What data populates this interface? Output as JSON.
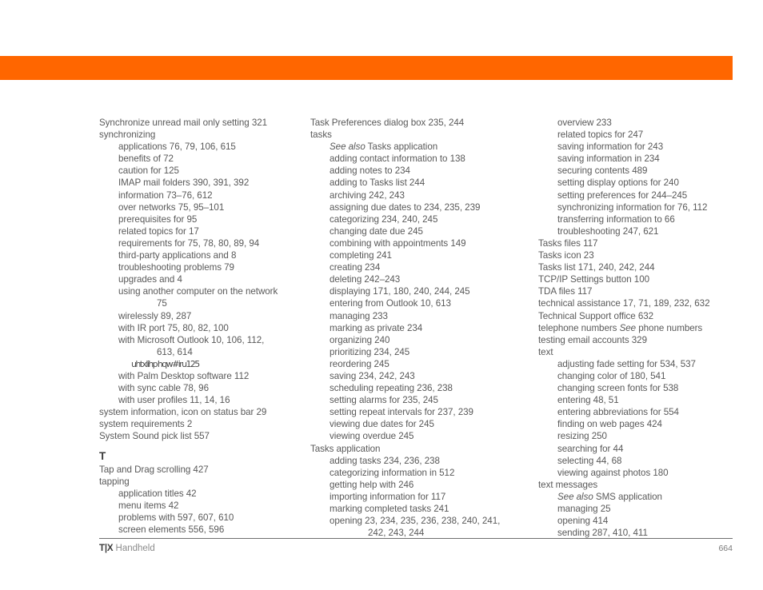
{
  "page": {
    "title": "T|X Handheld Index",
    "accent_color": "#ff6600",
    "text_color": "#595959",
    "page_number": "664"
  },
  "footer": {
    "brand": "T|X",
    "product": " Handheld",
    "page_number": "664"
  },
  "columns": [
    {
      "name": "column-1",
      "entries": [
        {
          "level": 0,
          "text": "Synchronize unread mail only setting 321"
        },
        {
          "level": 0,
          "text": "synchronizing"
        },
        {
          "level": 1,
          "text": "applications 76, 79, 106, 615"
        },
        {
          "level": 1,
          "text": "benefits of 72"
        },
        {
          "level": 1,
          "text": "caution for 125"
        },
        {
          "level": 1,
          "text": "IMAP mail folders 390, 391, 392"
        },
        {
          "level": 1,
          "text": "information 73–76, 612"
        },
        {
          "level": 1,
          "text": "over networks 75, 95–101"
        },
        {
          "level": 1,
          "text": "prerequisites for 95"
        },
        {
          "level": 1,
          "text": "related topics for 17"
        },
        {
          "level": 1,
          "text": "requirements for 75, 78, 80, 89, 94"
        },
        {
          "level": 1,
          "text": "third-party applications and 8"
        },
        {
          "level": 1,
          "text": "troubleshooting problems 79"
        },
        {
          "level": 1,
          "text": "upgrades and 4"
        },
        {
          "level": 1,
          "text": "using another computer on the network"
        },
        {
          "level": "cont",
          "text": "75"
        },
        {
          "level": 1,
          "text": "wirelessly 89, 287"
        },
        {
          "level": 1,
          "text": "with IR port 75, 80, 82, 100"
        },
        {
          "level": 1,
          "text": "with Microsoft Outlook 10, 106, 112,"
        },
        {
          "level": "cont",
          "text": "613, 614"
        },
        {
          "level": "glitch",
          "text": "uhtxlihp hqw#iru125"
        },
        {
          "level": 1,
          "text": "with Palm Desktop software 112"
        },
        {
          "level": 1,
          "text": "with sync cable 78, 96"
        },
        {
          "level": 1,
          "text": "with user profiles 11, 14, 16"
        },
        {
          "level": 0,
          "text": "system information, icon on status bar 29"
        },
        {
          "level": 0,
          "text": "system requirements 2"
        },
        {
          "level": 0,
          "text": "System Sound pick list 557"
        },
        {
          "level": "letter",
          "text": "T"
        },
        {
          "level": 0,
          "text": "Tap and Drag scrolling 427"
        },
        {
          "level": 0,
          "text": "tapping"
        },
        {
          "level": 1,
          "text": "application titles 42"
        },
        {
          "level": 1,
          "text": "menu items 42"
        },
        {
          "level": 1,
          "text": "problems with 597, 607, 610"
        },
        {
          "level": 1,
          "text": "screen elements 556, 596"
        }
      ]
    },
    {
      "name": "column-2",
      "entries": [
        {
          "level": 0,
          "text": "Task Preferences dialog box 235, 244"
        },
        {
          "level": 0,
          "text": "tasks"
        },
        {
          "level": 1,
          "italic_prefix": "See also",
          "text": " Tasks application"
        },
        {
          "level": 1,
          "text": "adding contact information to 138"
        },
        {
          "level": 1,
          "text": "adding notes to 234"
        },
        {
          "level": 1,
          "text": "adding to Tasks list 244"
        },
        {
          "level": 1,
          "text": "archiving 242, 243"
        },
        {
          "level": 1,
          "text": "assigning due dates to 234, 235, 239"
        },
        {
          "level": 1,
          "text": "categorizing 234, 240, 245"
        },
        {
          "level": 1,
          "text": "changing date due 245"
        },
        {
          "level": 1,
          "text": "combining with appointments 149"
        },
        {
          "level": 1,
          "text": "completing 241"
        },
        {
          "level": 1,
          "text": "creating 234"
        },
        {
          "level": 1,
          "text": "deleting 242–243"
        },
        {
          "level": 1,
          "text": "displaying 171, 180, 240, 244, 245"
        },
        {
          "level": 1,
          "text": "entering from Outlook 10, 613"
        },
        {
          "level": 1,
          "text": "managing 233"
        },
        {
          "level": 1,
          "text": "marking as private 234"
        },
        {
          "level": 1,
          "text": "organizing 240"
        },
        {
          "level": 1,
          "text": "prioritizing 234, 245"
        },
        {
          "level": 1,
          "text": "reordering 245"
        },
        {
          "level": 1,
          "text": "saving 234, 242, 243"
        },
        {
          "level": 1,
          "text": "scheduling repeating 236, 238"
        },
        {
          "level": 1,
          "text": "setting alarms for 235, 245"
        },
        {
          "level": 1,
          "text": "setting repeat intervals for 237, 239"
        },
        {
          "level": 1,
          "text": "viewing due dates for 245"
        },
        {
          "level": 1,
          "text": "viewing overdue 245"
        },
        {
          "level": 0,
          "text": "Tasks application"
        },
        {
          "level": 1,
          "text": "adding tasks 234, 236, 238"
        },
        {
          "level": 1,
          "text": "categorizing information in 512"
        },
        {
          "level": 1,
          "text": "getting help with 246"
        },
        {
          "level": 1,
          "text": "importing information for 117"
        },
        {
          "level": 1,
          "text": "marking completed tasks 241"
        },
        {
          "level": 1,
          "text": "opening 23, 234, 235, 236, 238, 240, 241,"
        },
        {
          "level": "cont",
          "text": "242, 243, 244"
        }
      ]
    },
    {
      "name": "column-3",
      "entries": [
        {
          "level": 1,
          "text": "overview 233"
        },
        {
          "level": 1,
          "text": "related topics for 247"
        },
        {
          "level": 1,
          "text": "saving information for 243"
        },
        {
          "level": 1,
          "text": "saving information in 234"
        },
        {
          "level": 1,
          "text": "securing contents 489"
        },
        {
          "level": 1,
          "text": "setting display options for 240"
        },
        {
          "level": 1,
          "text": "setting preferences for 244–245"
        },
        {
          "level": 1,
          "text": "synchronizing information for 76, 112"
        },
        {
          "level": 1,
          "text": "transferring information to 66"
        },
        {
          "level": 1,
          "text": "troubleshooting 247, 621"
        },
        {
          "level": 0,
          "text": "Tasks files 117"
        },
        {
          "level": 0,
          "text": "Tasks icon 23"
        },
        {
          "level": 0,
          "text": "Tasks list 171, 240, 242, 244"
        },
        {
          "level": 0,
          "text": "TCP/IP Settings button 100"
        },
        {
          "level": 0,
          "text": "TDA files 117"
        },
        {
          "level": 0,
          "text": "technical assistance 17, 71, 189, 232, 632"
        },
        {
          "level": 0,
          "text": "Technical Support office 632"
        },
        {
          "level": 0,
          "text": "telephone numbers ",
          "italic_mid": "See",
          "text_after": " phone numbers"
        },
        {
          "level": 0,
          "text": "testing email accounts 329"
        },
        {
          "level": 0,
          "text": "text"
        },
        {
          "level": 1,
          "text": "adjusting fade setting for 534, 537"
        },
        {
          "level": 1,
          "text": "changing color of 180, 541"
        },
        {
          "level": 1,
          "text": "changing screen fonts for 538"
        },
        {
          "level": 1,
          "text": "entering 48, 51"
        },
        {
          "level": 1,
          "text": "entering abbreviations for 554"
        },
        {
          "level": 1,
          "text": "finding on web pages 424"
        },
        {
          "level": 1,
          "text": "resizing 250"
        },
        {
          "level": 1,
          "text": "searching for 44"
        },
        {
          "level": 1,
          "text": "selecting 44, 68"
        },
        {
          "level": 1,
          "text": "viewing against photos 180"
        },
        {
          "level": 0,
          "text": "text messages"
        },
        {
          "level": 1,
          "italic_prefix": "See also",
          "text": " SMS application"
        },
        {
          "level": 1,
          "text": "managing 25"
        },
        {
          "level": 1,
          "text": "opening 414"
        },
        {
          "level": 1,
          "text": "sending 287, 410, 411"
        }
      ]
    }
  ]
}
